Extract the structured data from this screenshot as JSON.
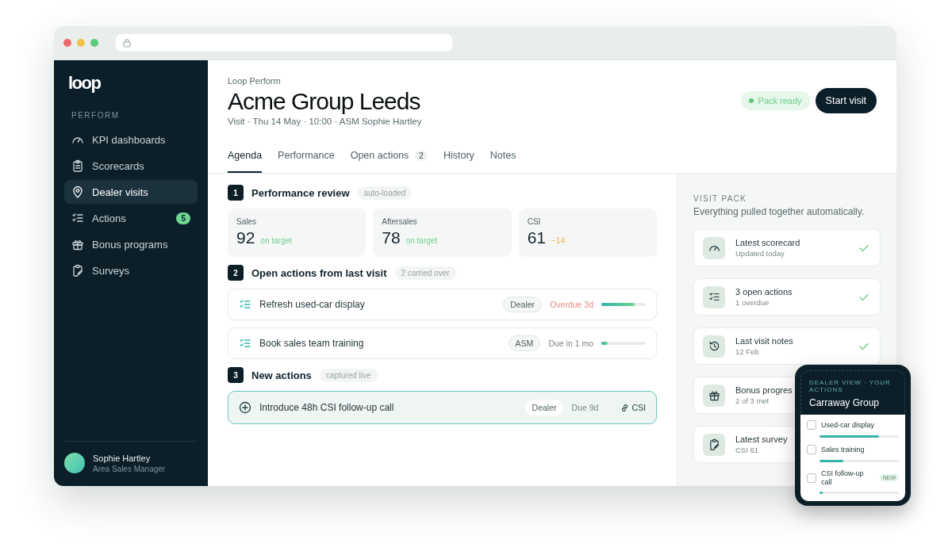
{
  "sidebar": {
    "logo": "loop",
    "section": "PERFORM",
    "items": [
      {
        "kind": "gauge",
        "label": "KPI dashboards",
        "selected": false
      },
      {
        "kind": "clipboard",
        "label": "Scorecards",
        "selected": false
      },
      {
        "kind": "pin",
        "label": "Dealer visits",
        "selected": true
      },
      {
        "kind": "checklist",
        "label": "Actions",
        "badge": "5",
        "selected": false
      },
      {
        "kind": "gift",
        "label": "Bonus programs",
        "selected": false
      },
      {
        "kind": "survey",
        "label": "Surveys",
        "selected": false
      }
    ],
    "user": {
      "name": "Sophie Hartley",
      "role": "Area Sales Manager"
    }
  },
  "header": {
    "eyebrow": "Loop Perform",
    "title": "Acme Group Leeds",
    "subtitle": "Visit · Thu 14 May · 10:00 · ASM Sophie Hartley",
    "status": "Pack ready",
    "button": "Start visit"
  },
  "tabs": [
    {
      "label": "Agenda",
      "selected": true
    },
    {
      "label": "Performance",
      "selected": false
    },
    {
      "label": "Open actions",
      "count": "2",
      "selected": false
    },
    {
      "label": "History",
      "selected": false
    },
    {
      "label": "Notes",
      "selected": false
    }
  ],
  "sections": [
    {
      "kind": "metrics",
      "number": "1",
      "title": "Performance review",
      "tag": "auto-loaded",
      "metrics": [
        {
          "label": "Sales",
          "value": "92",
          "note": "on target",
          "color": "#6fcf8f"
        },
        {
          "label": "Aftersales",
          "value": "78",
          "note": "on target",
          "color": "#6fcf8f"
        },
        {
          "label": "CSI",
          "value": "61",
          "note": "−14",
          "color": "#f0b24b"
        }
      ]
    },
    {
      "kind": "actions",
      "number": "2",
      "title": "Open actions from last visit",
      "tag": "2 carried over",
      "actions": [
        {
          "label": "Refresh used-car display",
          "owner": "Dealer",
          "due": "Overdue 3d",
          "overdue": true,
          "level": 0.75
        },
        {
          "label": "Book sales team training",
          "owner": "ASM",
          "due": "Due in 1 mo",
          "overdue": false,
          "level": 0.15
        }
      ]
    },
    {
      "kind": "new",
      "number": "3",
      "title": "New actions",
      "tag": "captured live",
      "actions": [
        {
          "label": "Introduce 48h CSI follow-up call",
          "owner": "Dealer",
          "due": "Due 9d",
          "link": "CSI"
        }
      ]
    }
  ],
  "visit_pack": {
    "heading": "VISIT PACK",
    "subtitle": "Everything pulled together automatically.",
    "items": [
      {
        "kind": "gauge",
        "title": "Latest scorecard",
        "detail": "Updated today",
        "done": true
      },
      {
        "kind": "checklist",
        "title": "3 open actions",
        "detail": "1 overdue",
        "done": true
      },
      {
        "kind": "history",
        "title": "Last visit notes",
        "detail": "12 Feb",
        "done": true
      },
      {
        "kind": "gift",
        "title": "Bonus progres",
        "detail": "2 of 3 met"
      },
      {
        "kind": "survey",
        "title": "Latest survey",
        "detail": "CSI 61"
      }
    ]
  },
  "phone": {
    "eyebrow": "DEALER VIEW · YOUR ACTIONS",
    "title": "Carraway Group",
    "items": [
      {
        "label": "Used-car display",
        "checked": false,
        "level": 0.75
      },
      {
        "label": "Sales training",
        "checked": false,
        "level": 0.3
      },
      {
        "label": "CSI follow-up call",
        "checked": false,
        "level": 0.04,
        "badge": "NEW"
      }
    ]
  }
}
